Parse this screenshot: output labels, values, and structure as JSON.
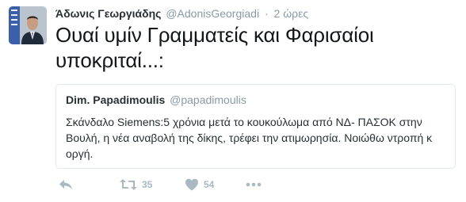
{
  "tweet": {
    "author_name": "Άδωνις Γεωργιάδης",
    "author_handle": "@AdonisGeorgiadi",
    "separator": "·",
    "timestamp": "2 ώρες",
    "text": "Ουαί υμίν Γραμματείς και Φαρισαίοι υποκριταί...:"
  },
  "quoted_tweet": {
    "author_name": "Dim. Papadimoulis",
    "author_handle": "@papadimoulis",
    "text": "Σκάνδαλο Siemens:5 χρόνια μετά το κουκούλωμα από ΝΔ- ΠΑΣΟΚ στην Βουλή, η νέα αναβολή της δίκης, τρέφει την ατιμωρησία. Νοιώθω ντροπή κ οργή."
  },
  "actions": {
    "reply_icon": "reply-icon",
    "retweet_icon": "retweet-icon",
    "retweet_count": "35",
    "like_icon": "heart-icon",
    "like_count": "54",
    "more_icon": "more-dots-icon"
  },
  "colors": {
    "name": "#292f33",
    "secondary": "#8899a6",
    "action_icons": "#aab8c2",
    "border": "#e1e8ed"
  }
}
